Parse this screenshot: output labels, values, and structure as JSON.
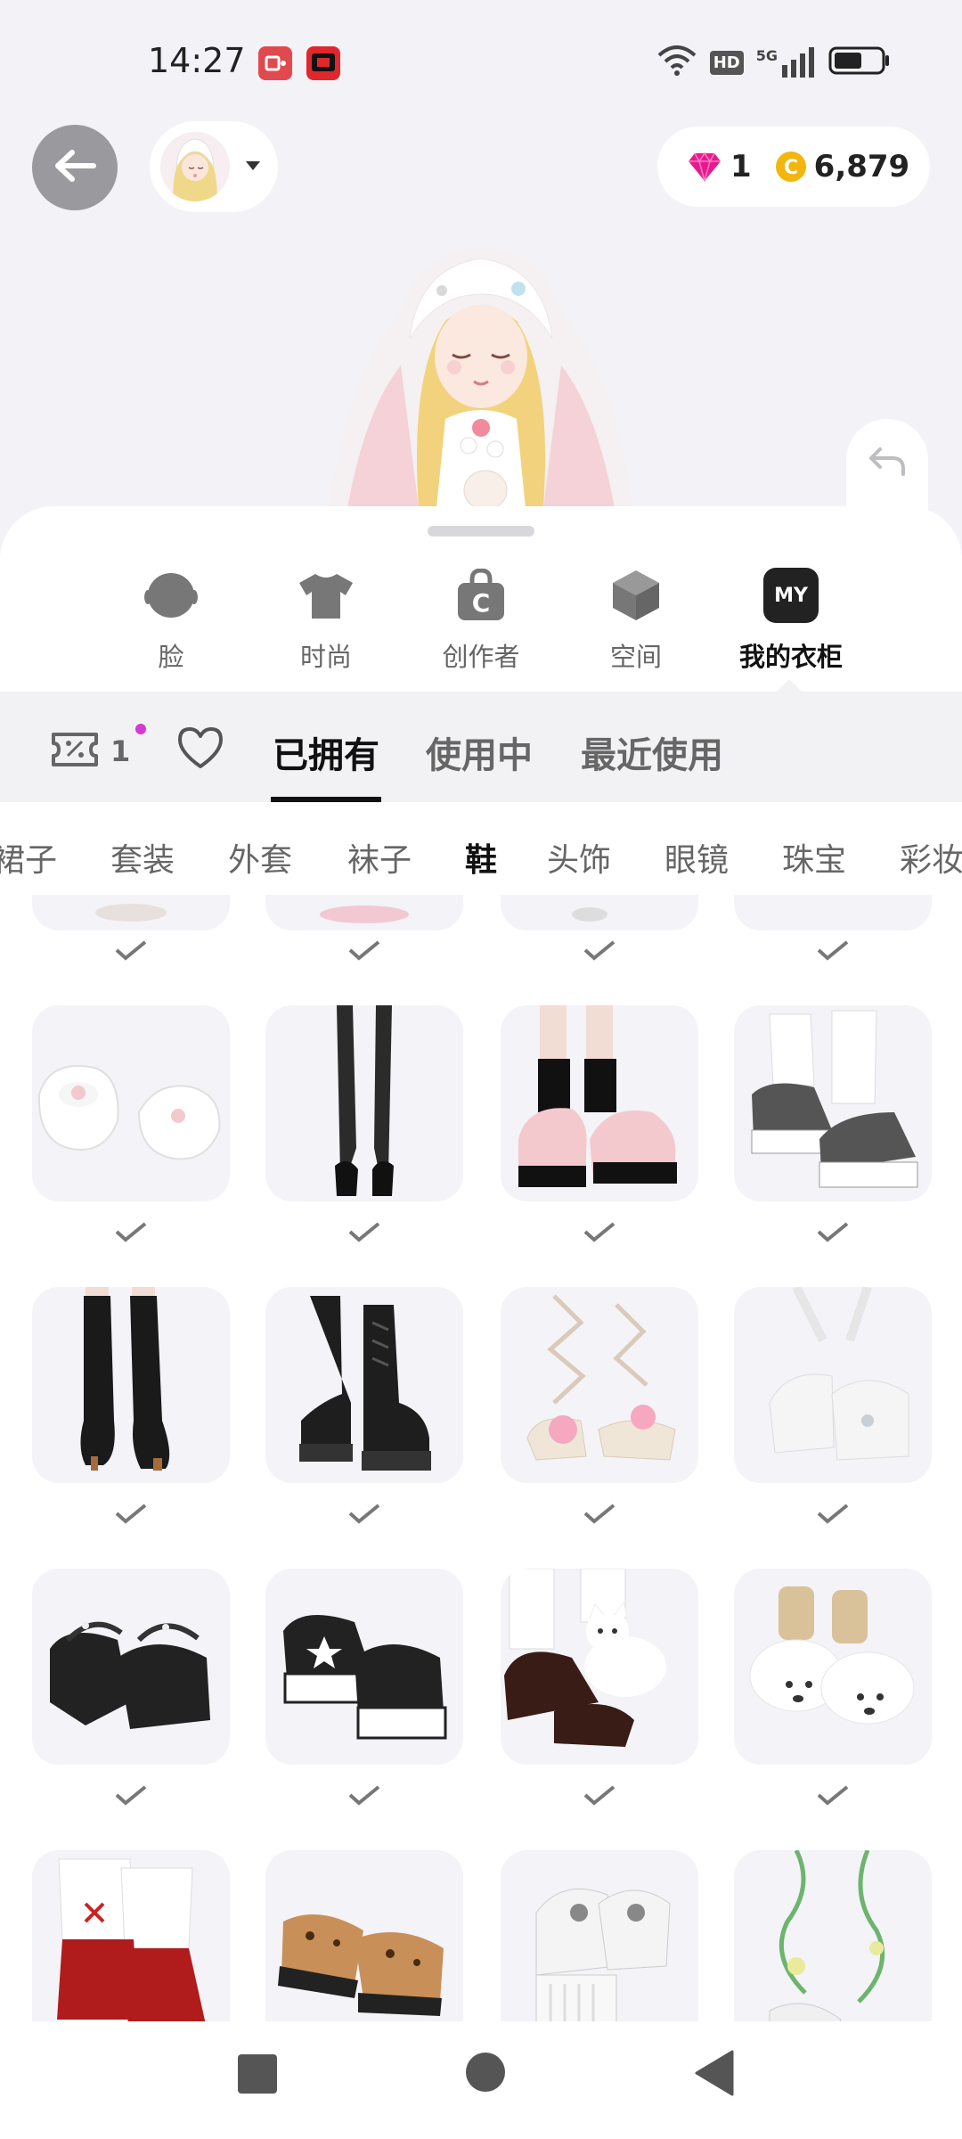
{
  "status_bar": {
    "time": "14:27",
    "network": "5G",
    "hd": "HD",
    "icons": [
      "screen-record-icon",
      "app-notification-icon",
      "wifi-icon",
      "hd-icon",
      "signal-5g-icon",
      "battery-icon"
    ]
  },
  "header": {
    "back_icon": "arrow-left-icon",
    "avatar_icon": "avatar-icon",
    "dropdown_icon": "caret-down-icon",
    "gems": "1",
    "coins": "6,879",
    "gem_color": "#e8188f",
    "coin_color": "#f2b60f"
  },
  "categories": [
    {
      "label": "脸",
      "icon": "face-icon"
    },
    {
      "label": "时尚",
      "icon": "tshirt-icon"
    },
    {
      "label": "创作者",
      "icon": "creator-bag-icon"
    },
    {
      "label": "空间",
      "icon": "cube-icon"
    },
    {
      "label": "我的衣柜",
      "icon": "my-wardrobe-icon",
      "badge": "MY"
    }
  ],
  "tabs": {
    "coupon_count": "1",
    "items": [
      "已拥有",
      "使用中",
      "最近使用"
    ],
    "active": "已拥有"
  },
  "subcategories": [
    "裙子",
    "套装",
    "外套",
    "袜子",
    "鞋",
    "头饰",
    "眼镜",
    "珠宝",
    "彩妆"
  ],
  "active_subcategory": "鞋",
  "items": [
    {
      "name": "white-bunny-clogs",
      "owned": true
    },
    {
      "name": "black-tights-platform-heels",
      "owned": true
    },
    {
      "name": "pink-mary-jane-platforms",
      "owned": true
    },
    {
      "name": "white-leg-warmer-sneakers",
      "owned": true
    },
    {
      "name": "black-knee-high-boots",
      "owned": true
    },
    {
      "name": "black-lace-up-platform-boots",
      "owned": true
    },
    {
      "name": "flower-lace-up-sandals",
      "owned": true
    },
    {
      "name": "white-ribbon-shoes",
      "owned": true
    },
    {
      "name": "black-pearl-strap-heels",
      "owned": true
    },
    {
      "name": "black-white-star-sneakers",
      "owned": true
    },
    {
      "name": "kitten-mary-janes",
      "owned": true
    },
    {
      "name": "polar-bear-slippers",
      "owned": true
    },
    {
      "name": "red-lace-boots",
      "owned": false
    },
    {
      "name": "leopard-slides",
      "owned": false
    },
    {
      "name": "white-platform-shoes",
      "owned": false
    },
    {
      "name": "green-vine-sandals",
      "owned": false
    }
  ],
  "nav": {
    "icons": [
      "recents-square-icon",
      "home-circle-icon",
      "back-triangle-icon"
    ]
  }
}
